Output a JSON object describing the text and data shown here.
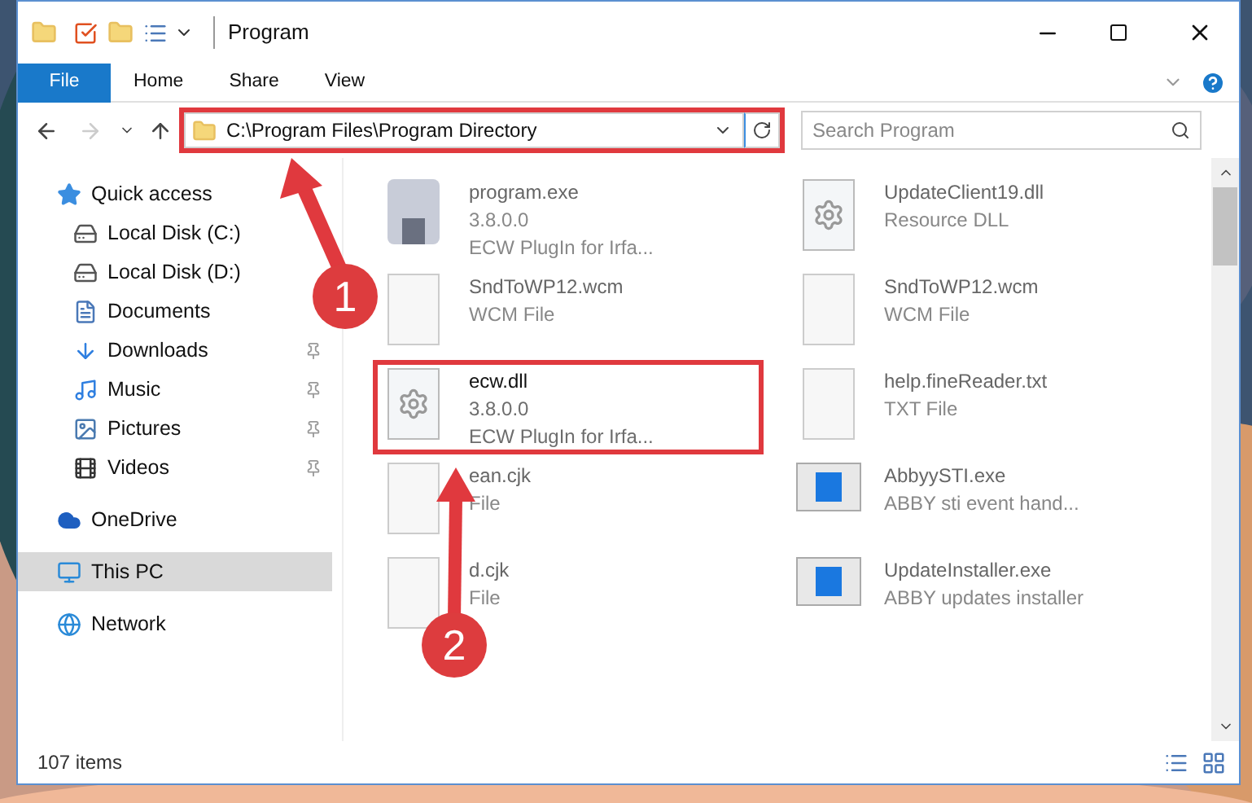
{
  "window": {
    "title": "Program"
  },
  "ribbon_tabs": [
    {
      "label": "File",
      "selected": true
    },
    {
      "label": "Home",
      "selected": false
    },
    {
      "label": "Share",
      "selected": false
    },
    {
      "label": "View",
      "selected": false
    }
  ],
  "address_bar": {
    "path": "C:\\Program Files\\Program Directory",
    "highlighted": true
  },
  "search": {
    "placeholder": "Search Program"
  },
  "nav_pane": [
    {
      "label": "Quick access",
      "kind": "star",
      "selected": false,
      "children": [
        {
          "label": "Local Disk (C:)",
          "kind": "disk",
          "pinned": false
        },
        {
          "label": "Local Disk (D:)",
          "kind": "disk",
          "pinned": false
        },
        {
          "label": "Documents",
          "kind": "doc",
          "pinned": false
        },
        {
          "label": "Downloads",
          "kind": "download",
          "pinned": true
        },
        {
          "label": "Music",
          "kind": "music",
          "pinned": true
        },
        {
          "label": "Pictures",
          "kind": "pictures",
          "pinned": true
        },
        {
          "label": "Videos",
          "kind": "videos",
          "pinned": true
        }
      ]
    },
    {
      "label": "OneDrive",
      "kind": "cloud",
      "selected": false
    },
    {
      "label": "This PC",
      "kind": "pc",
      "selected": true
    },
    {
      "label": "Network",
      "kind": "network",
      "selected": false
    }
  ],
  "files": [
    {
      "name": "program.exe",
      "lines": [
        "3.8.0.0",
        "ECW PlugIn for Irfa..."
      ],
      "kind": "program",
      "blurred": true,
      "highlighted": false
    },
    {
      "name": "UpdateClient19.dll",
      "lines": [
        "Resource DLL"
      ],
      "kind": "gear",
      "blurred": true,
      "highlighted": false
    },
    {
      "name": "SndToWP12.wcm",
      "lines": [
        "WCM File"
      ],
      "kind": "blank",
      "blurred": true,
      "highlighted": false
    },
    {
      "name": "SndToWP12.wcm",
      "lines": [
        "WCM File"
      ],
      "kind": "blank",
      "blurred": true,
      "highlighted": false
    },
    {
      "name": "ecw.dll",
      "lines": [
        "3.8.0.0",
        "ECW PlugIn for Irfa..."
      ],
      "kind": "gear",
      "blurred": false,
      "highlighted": true
    },
    {
      "name": "help.fineReader.txt",
      "lines": [
        "TXT File"
      ],
      "kind": "blank",
      "blurred": true,
      "highlighted": false
    },
    {
      "name": "ean.cjk",
      "lines": [
        "File"
      ],
      "kind": "blank",
      "blurred": true,
      "highlighted": false
    },
    {
      "name": "AbbyySTI.exe",
      "lines": [
        "ABBY sti event hand..."
      ],
      "kind": "app",
      "blurred": true,
      "highlighted": false
    },
    {
      "name": "d.cjk",
      "lines": [
        "File"
      ],
      "kind": "blank",
      "blurred": true,
      "highlighted": false
    },
    {
      "name": "UpdateInstaller.exe",
      "lines": [
        "ABBY updates installer"
      ],
      "kind": "app",
      "blurred": true,
      "highlighted": false
    }
  ],
  "status_bar": {
    "count": "107 items"
  },
  "annotations": [
    {
      "label": "1"
    },
    {
      "label": "2"
    }
  ]
}
